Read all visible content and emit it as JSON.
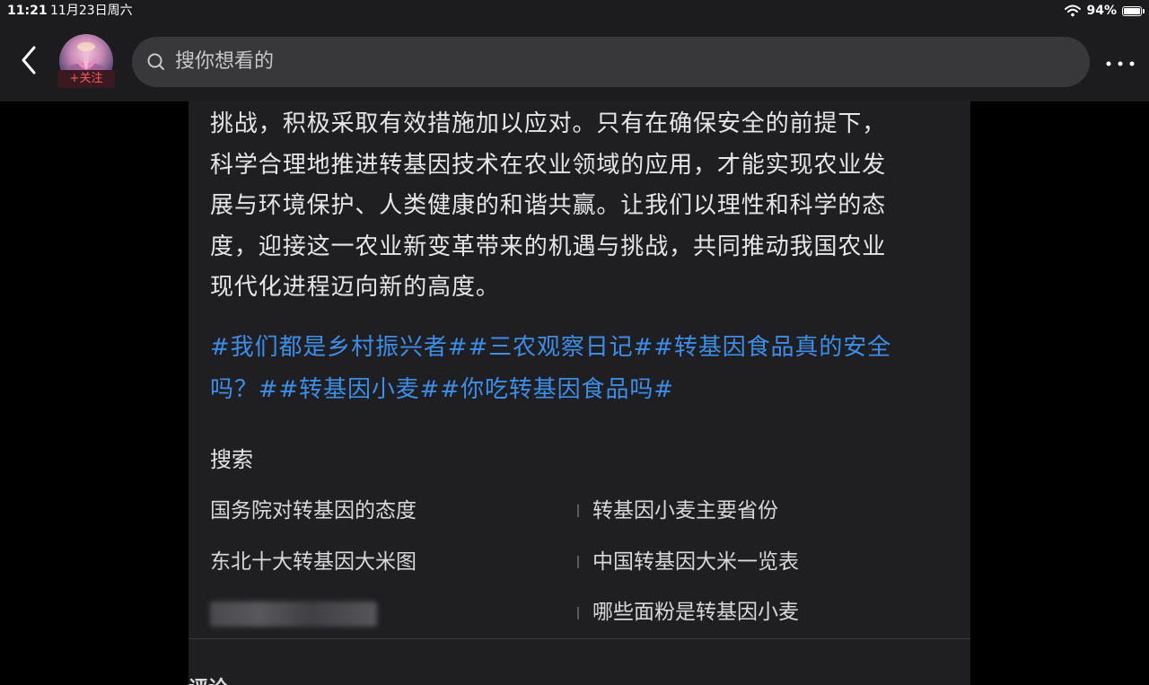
{
  "status_bar": {
    "time": "11:21",
    "date": "11月23日周六",
    "battery": "94%",
    "battery_level": 0.94,
    "wifi_icon": "wifi-icon",
    "battery_icon": "battery-icon"
  },
  "nav": {
    "back_icon": "chevron-left-icon",
    "follow_label": "+关注",
    "search_placeholder": "搜你想看的",
    "search_icon": "search-icon",
    "more_icon": "more-dots-icon"
  },
  "article": {
    "lines": [
      "挑战，积极采取有效措施加以应对。只有在确保安全的前提下，",
      "科学合理地推进转基因技术在农业领域的应用，才能实现农业发",
      "展与环境保护、人类健康的和谐共赢。让我们以理性和科学的态",
      "度，迎接这一农业新变革带来的机遇与挑战，共同推动我国农业",
      "现代化进程迈向新的高度。"
    ],
    "hashtag_lines": [
      "#我们都是乡村振兴者##三农观察日记##转基因食品真的安全",
      "吗？##转基因小麦##你吃转基因食品吗#"
    ]
  },
  "search_section": {
    "title": "搜索",
    "items": [
      "国务院对转基因的态度",
      "转基因小麦主要省份",
      "东北十大转基因大米图",
      "中国转基因大米一览表",
      "哪些面粉是转基因小麦"
    ]
  },
  "comments": {
    "label": "评论"
  },
  "colors": {
    "background": "#000000",
    "bar": "#1c1c1e",
    "panel": "#1f1f22",
    "text": "#e6e6e6",
    "link": "#3b8eea",
    "follow": "#ff5a5f"
  }
}
